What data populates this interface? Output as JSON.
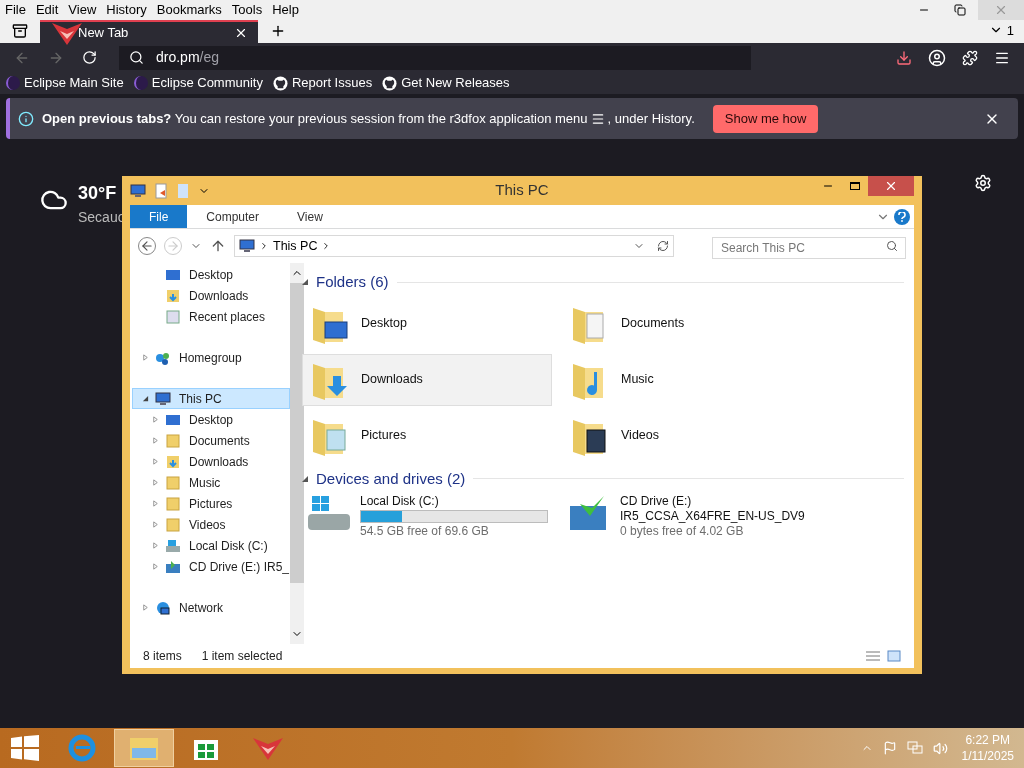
{
  "browser": {
    "menu_bar": [
      "File",
      "Edit",
      "View",
      "History",
      "Bookmarks",
      "Tools",
      "Help"
    ],
    "tabs": [
      {
        "label": "New Tab",
        "selected": true
      }
    ],
    "tab_count": "1",
    "address": {
      "host": "dro.pm",
      "path": "/eg"
    },
    "bookmarks": [
      {
        "label": "Eclipse Main Site",
        "kind": "eclipse"
      },
      {
        "label": "Eclipse Community",
        "kind": "eclipse"
      },
      {
        "label": "Report Issues",
        "kind": "github"
      },
      {
        "label": "Get New Releases",
        "kind": "github"
      }
    ],
    "notification": {
      "message_start": "**Open previous tabs?** You can restore your previous session from the r3dfox application menu",
      "message_end": ", under History.",
      "button": "Show me how"
    },
    "weather": {
      "temperature": "30°F",
      "location": "Secauc"
    }
  },
  "explorer": {
    "title": "This PC",
    "ribbon_tabs": [
      {
        "label": "File",
        "selected": true
      },
      {
        "label": "Computer",
        "selected": false
      },
      {
        "label": "View",
        "selected": false
      }
    ],
    "breadcrumb": "This PC",
    "search": {
      "placeholder": "Search This PC"
    },
    "nav_groups": [
      [
        {
          "label": "Desktop",
          "kind": "desktop"
        },
        {
          "label": "Downloads",
          "kind": "downloads"
        },
        {
          "label": "Recent places",
          "kind": "recent"
        }
      ],
      [
        {
          "label": "Homegroup",
          "kind": "homegroup",
          "expanded": false,
          "selected": false
        }
      ],
      [
        {
          "label": "This PC",
          "kind": "pc",
          "expanded": true,
          "selected": true,
          "children": [
            {
              "label": "Desktop",
              "kind": "desktop",
              "expanded": false,
              "selected": false
            },
            {
              "label": "Documents",
              "kind": "folder",
              "expanded": false,
              "selected": false
            },
            {
              "label": "Downloads",
              "kind": "downloads",
              "expanded": false,
              "selected": false
            },
            {
              "label": "Music",
              "kind": "folder",
              "expanded": false,
              "selected": false
            },
            {
              "label": "Pictures",
              "kind": "folder",
              "expanded": false,
              "selected": false
            },
            {
              "label": "Videos",
              "kind": "folder",
              "expanded": false,
              "selected": false
            },
            {
              "label": "Local Disk (C:)",
              "kind": "disk",
              "expanded": false,
              "selected": false
            },
            {
              "label": "CD Drive (E:) IR5_",
              "kind": "cd",
              "expanded": false,
              "selected": false
            }
          ]
        }
      ],
      [
        {
          "label": "Network",
          "kind": "network",
          "expanded": false,
          "selected": false
        }
      ]
    ],
    "folders": {
      "title": "Folders (6)",
      "items": [
        {
          "name": "Desktop",
          "kind": "desktop",
          "selected": false
        },
        {
          "name": "Documents",
          "kind": "documents",
          "selected": false
        },
        {
          "name": "Downloads",
          "kind": "downloads",
          "selected": true
        },
        {
          "name": "Music",
          "kind": "music",
          "selected": false
        },
        {
          "name": "Pictures",
          "kind": "pictures",
          "selected": false
        },
        {
          "name": "Videos",
          "kind": "videos",
          "selected": false
        }
      ]
    },
    "drives": {
      "title": "Devices and drives (2)",
      "items": [
        {
          "name": "Local Disk (C:)",
          "kind": "disk",
          "level": 0.22,
          "free": "54.5 GB free of 69.6 GB"
        },
        {
          "name": "CD Drive (E:)",
          "kind": "cd",
          "label": "IR5_CCSA_X64FRE_EN-US_DV9",
          "free": "0 bytes free of 4.02 GB"
        }
      ]
    },
    "status": {
      "items": "8 items",
      "selection": "1 item selected"
    }
  },
  "taskbar": {
    "apps": [
      {
        "kind": "ie",
        "selected": false
      },
      {
        "kind": "explorer",
        "selected": true
      },
      {
        "kind": "store",
        "selected": false
      },
      {
        "kind": "r3dfox",
        "selected": false
      }
    ],
    "time": "6:22 PM",
    "date": "1/11/2025"
  }
}
